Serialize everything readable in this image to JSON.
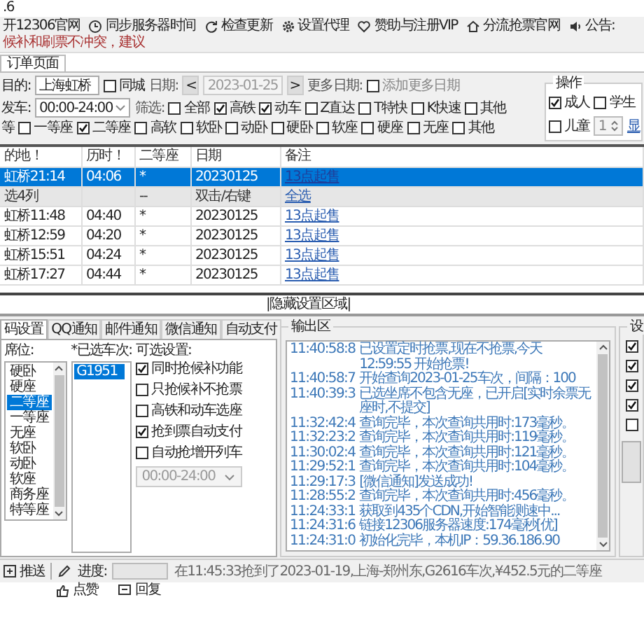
{
  "window": {
    "title": ".6"
  },
  "toolbar": [
    {
      "label": "开12306官网"
    },
    {
      "label": "同步服务器时间"
    },
    {
      "label": "检查更新"
    },
    {
      "label": "设置代理"
    },
    {
      "label": "赞助与注册VIP"
    },
    {
      "label": "分流抢票官网"
    },
    {
      "label": "公告:"
    }
  ],
  "notice": "候补和刷票不冲突，建议",
  "tabs": [
    {
      "label": "订单页面",
      "selected": true
    }
  ],
  "query": {
    "destination_label": "目的:",
    "destination": "上海虹桥",
    "same_city": {
      "label": "同城",
      "checked": false
    },
    "date_label": "日期:",
    "prev": "<",
    "date": {
      "value": "2023-01-25",
      "disabled": true
    },
    "next": ">",
    "more_dates_label": "更多日期:",
    "add_more_dates": {
      "label": "添加更多日期",
      "checked": false,
      "disabled": true
    },
    "depart_label": "发车:",
    "depart_time": "00:00-24:00",
    "filter_label": "筛选:",
    "train_types": [
      {
        "label": "全部",
        "checked": false
      },
      {
        "label": "高铁",
        "checked": true
      },
      {
        "label": "动车",
        "checked": true
      },
      {
        "label": "Z直达",
        "checked": false
      },
      {
        "label": "T特快",
        "checked": false
      },
      {
        "label": "K快速",
        "checked": false
      },
      {
        "label": "其他",
        "checked": false
      }
    ],
    "seat_cut_label": "等",
    "seat_types": [
      {
        "label": "一等座",
        "checked": false
      },
      {
        "label": "二等座",
        "checked": true
      },
      {
        "label": "高软",
        "checked": false
      },
      {
        "label": "软卧",
        "checked": false
      },
      {
        "label": "动卧",
        "checked": false
      },
      {
        "label": "硬卧",
        "checked": false
      },
      {
        "label": "软座",
        "checked": false
      },
      {
        "label": "硬座",
        "checked": false
      },
      {
        "label": "无座",
        "checked": false
      },
      {
        "label": "其他",
        "checked": false
      }
    ]
  },
  "operation": {
    "title": "操作",
    "passengers": [
      {
        "label": "成人",
        "checked": true
      },
      {
        "label": "学生",
        "checked": false
      },
      {
        "label": "儿童",
        "checked": false
      }
    ],
    "child_count": "1",
    "link": "显"
  },
  "table": {
    "columns": [
      "的地！",
      "历时！",
      "二等座",
      "日期",
      "备注"
    ],
    "rows": [
      {
        "kind": "train",
        "selected": true,
        "cells": [
          "虹桥21:14",
          "04:06",
          "*",
          "20230125"
        ],
        "link": "13点起售"
      },
      {
        "kind": "summary",
        "selected": false,
        "cells": [
          "选4列",
          "",
          "--",
          "双击/右键"
        ],
        "link": "全选"
      },
      {
        "kind": "train",
        "selected": false,
        "cells": [
          "虹桥11:48",
          "04:40",
          "*",
          "20230125"
        ],
        "link": "13点起售"
      },
      {
        "kind": "train",
        "selected": false,
        "cells": [
          "虹桥12:59",
          "04:20",
          "*",
          "20230125"
        ],
        "link": "13点起售"
      },
      {
        "kind": "train",
        "selected": false,
        "cells": [
          "虹桥15:51",
          "04:24",
          "*",
          "20230125"
        ],
        "link": "13点起售"
      },
      {
        "kind": "train",
        "selected": false,
        "cells": [
          "虹桥17:27",
          "04:44",
          "*",
          "20230125"
        ],
        "link": "13点起售"
      }
    ]
  },
  "hide_toggle": "|隐藏设置区域|",
  "settings": {
    "tabs": [
      {
        "label": "码设置",
        "selected": true
      },
      {
        "label": "QQ通知",
        "selected": false
      },
      {
        "label": "邮件通知",
        "selected": false
      },
      {
        "label": "微信通知",
        "selected": false
      },
      {
        "label": "自动支付",
        "selected": false
      }
    ],
    "seat_label": "席位:",
    "seats": [
      {
        "label": "硬卧",
        "selected": false
      },
      {
        "label": "硬座",
        "selected": false
      },
      {
        "label": "二等座",
        "selected": true
      },
      {
        "label": "一等座",
        "selected": false
      },
      {
        "label": "无座",
        "selected": false
      },
      {
        "label": "软卧",
        "selected": false
      },
      {
        "label": "动卧",
        "selected": false
      },
      {
        "label": "软座",
        "selected": false
      },
      {
        "label": "商务座",
        "selected": false
      },
      {
        "label": "特等座",
        "selected": false
      }
    ],
    "trains_label": "*已选车次:",
    "trains": [
      {
        "label": "G1951",
        "selected": true
      }
    ],
    "options_label": "可选设置:",
    "options": [
      {
        "label": "同时抢候补功能",
        "checked": true
      },
      {
        "label": "只抢候补不抢票",
        "checked": false
      },
      {
        "label": "高铁和动车选座",
        "checked": false
      },
      {
        "label": "抢到票自动支付",
        "checked": true
      },
      {
        "label": "自动抢增开列车",
        "checked": false
      }
    ],
    "option_time": {
      "value": "00:00-24:00",
      "disabled": true
    }
  },
  "log": {
    "title": "输出区",
    "lines": [
      {
        "time": "11:40:58:8",
        "message": "已设置定时抢票,现在不抢票,今天 12:59:55 开始抢票!"
      },
      {
        "time": "11:40:58:7",
        "message": "开始查询2023-01-25车次，间隔：100"
      },
      {
        "time": "11:40:39:3",
        "message": "已选坐席不包含无座，已开启[实时余票无座时,不提交]"
      },
      {
        "time": "11:32:42:4",
        "message": "查询完毕，本次查询共用时:173毫秒。"
      },
      {
        "time": "11:32:23:2",
        "message": "查询完毕，本次查询共用时:119毫秒。"
      },
      {
        "time": "11:30:02:4",
        "message": "查询完毕，本次查询共用时:121毫秒。"
      },
      {
        "time": "11:29:52:1",
        "message": "查询完毕，本次查询共用时:104毫秒。"
      },
      {
        "time": "11:29:17:3",
        "message": "[微信通知]发送成功!"
      },
      {
        "time": "11:28:55:2",
        "message": "查询完毕，本次查询共用时:456毫秒。"
      },
      {
        "time": "11:24:33:1",
        "message": "获取到435个CDN,开始智能测速中..."
      },
      {
        "time": "11:24:31:6",
        "message": "链接12306服务器速度:174毫秒[优]"
      },
      {
        "time": "11:24:31:0",
        "message": "初始化完毕，本机IP：59.36.186.90"
      }
    ]
  },
  "side": {
    "title": "设",
    "checks": [
      {
        "checked": true
      },
      {
        "checked": true
      },
      {
        "checked": true
      },
      {
        "checked": true
      },
      {
        "checked": false
      }
    ]
  },
  "status": {
    "push": "推送",
    "progress_label": "进度:",
    "progress": {
      "level": 0
    },
    "message": "在11:45:33抢到了2023-01-19,上海-郑州东,G2616车次,¥452.5元的二等座"
  },
  "footer": [
    {
      "label": "点赞"
    },
    {
      "label": "回复"
    }
  ]
}
